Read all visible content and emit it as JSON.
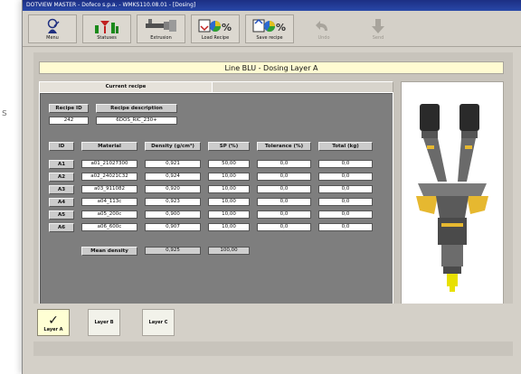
{
  "side_glyph": "s",
  "window": {
    "title": "DOTVIEW MASTER - Dofeco s.p.a. - WMKS110.08.01 - [Dosing]"
  },
  "toolbar": {
    "buttons": [
      {
        "label": "Menu",
        "icon": "menu-icon",
        "enabled": true
      },
      {
        "label": "Statuses",
        "icon": "statuses-icon",
        "enabled": true
      },
      {
        "label": "Extrusion",
        "icon": "extrusion-icon",
        "enabled": true
      },
      {
        "label": "Load Recipe",
        "icon": "load-recipe-icon",
        "enabled": true
      },
      {
        "label": "Save recipe",
        "icon": "save-recipe-icon",
        "enabled": true
      },
      {
        "label": "Undo",
        "icon": "undo-icon",
        "enabled": false
      },
      {
        "label": "Send",
        "icon": "send-icon",
        "enabled": false
      }
    ]
  },
  "main": {
    "title": "Line BLU - Dosing Layer A",
    "tab": "Current recipe",
    "recipe": {
      "id_label": "Recipe ID",
      "desc_label": "Recipe description",
      "id": "242",
      "description": "6DOS_RIC_230+"
    },
    "table": {
      "headers": [
        "ID",
        "Material",
        "Density (g/cm³)",
        "SP (%)",
        "Tolerance (%)",
        "Total (kg)"
      ],
      "rows": [
        [
          "A1",
          "a01_21027300",
          "0,921",
          "50,00",
          "0,0",
          "0,0"
        ],
        [
          "A2",
          "a02_24021C32",
          "0,924",
          "10,00",
          "0,0",
          "0,0"
        ],
        [
          "A3",
          "a03_911082",
          "0,920",
          "10,00",
          "0,0",
          "0,0"
        ],
        [
          "A4",
          "a04_113c",
          "0,923",
          "10,00",
          "0,0",
          "0,0"
        ],
        [
          "A5",
          "a05_200c",
          "0,900",
          "10,00",
          "0,0",
          "0,0"
        ],
        [
          "A6",
          "a06_600c",
          "0,907",
          "10,00",
          "0,0",
          "0,0"
        ]
      ]
    },
    "mean": {
      "label": "Mean density",
      "density": "0,925",
      "sp_total": "100,00"
    }
  },
  "layers": [
    {
      "label": "Layer A",
      "active": true
    },
    {
      "label": "Layer B",
      "active": false
    },
    {
      "label": "Layer C",
      "active": false
    }
  ],
  "colors": {
    "title_bar": "#1c2f84",
    "title_highlight": "#fffbd2",
    "hopper_yellow": "#e6b830",
    "screw_yellow": "#e8e000"
  }
}
